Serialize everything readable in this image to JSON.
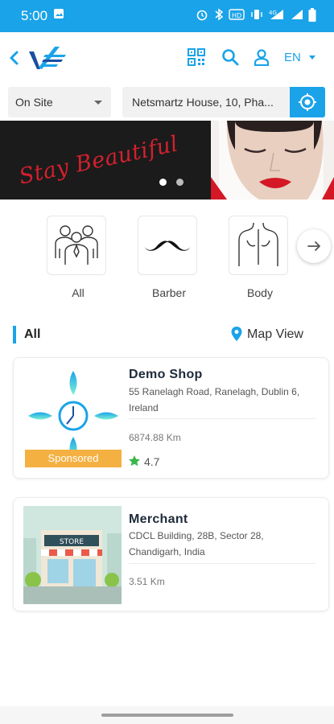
{
  "status_bar": {
    "time": "5:00",
    "icons": [
      "image-icon",
      "alarm-icon",
      "bluetooth-icon",
      "hd-icon",
      "vibrate-icon",
      "signal-icon",
      "wifi-icon",
      "battery-icon"
    ]
  },
  "header": {
    "language": "EN",
    "icons": [
      "back-icon",
      "brand-logo",
      "qr-code-icon",
      "search-icon",
      "user-icon"
    ]
  },
  "filters": {
    "service_type": "On Site",
    "address": "Netsmartz House, 10, Pha..."
  },
  "banner": {
    "headline": "Stay Beautiful",
    "slides": 2,
    "active_slide": 1
  },
  "categories": [
    {
      "label": "All",
      "icon": "group-icon"
    },
    {
      "label": "Barber",
      "icon": "mustache-icon"
    },
    {
      "label": "Body",
      "icon": "back-body-icon"
    }
  ],
  "list": {
    "title": "All",
    "map_view_label": "Map View"
  },
  "shops": [
    {
      "name": "Demo Shop",
      "address": "55 Ranelagh Road, Ranelagh, Dublin 6, Ireland",
      "distance": "6874.88 Km",
      "rating": "4.7",
      "badge": "Sponsored"
    },
    {
      "name": "Merchant",
      "address": "CDCL Building, 28B, Sector 28, Chandigarh, India",
      "distance": "3.51 Km",
      "store_sign": "STORE"
    }
  ],
  "colors": {
    "primary": "#1aa3e8",
    "banner_text": "#d3202e",
    "sponsored": "#f5b042",
    "star": "#3bb54a"
  }
}
